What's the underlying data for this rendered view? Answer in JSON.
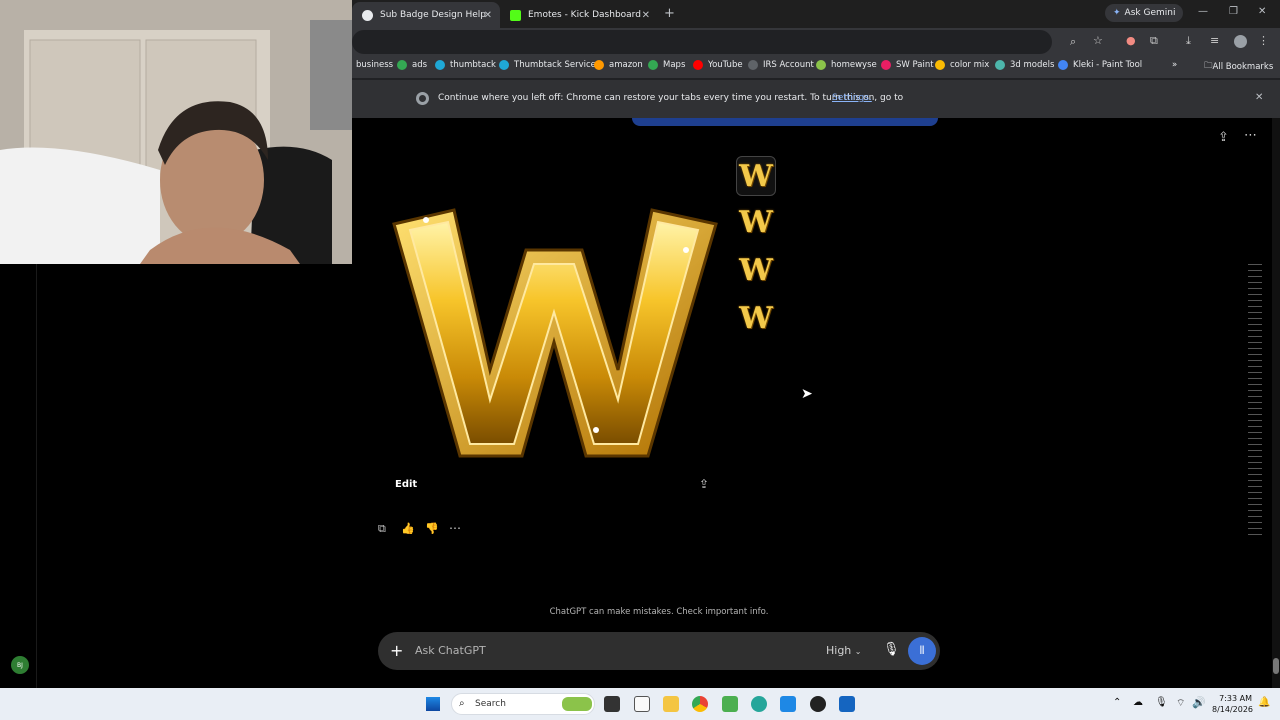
{
  "tabs": [
    {
      "label": "Sub Badge Design Help"
    },
    {
      "label": "Emotes - Kick Dashboard"
    }
  ],
  "new_tab": "+",
  "ask_gemini": "Ask Gemini",
  "bookmarks": [
    {
      "label": "business",
      "color": "#9aa0a6"
    },
    {
      "label": "ads",
      "color": "#34a853"
    },
    {
      "label": "thumbtack",
      "color": "#1fa8d6"
    },
    {
      "label": "Thumbtack Services",
      "color": "#1fa8d6"
    },
    {
      "label": "amazon",
      "color": "#ff9900"
    },
    {
      "label": "Maps",
      "color": "#34a853"
    },
    {
      "label": "YouTube",
      "color": "#ff0000"
    },
    {
      "label": "IRS Account",
      "color": "#5f6368"
    },
    {
      "label": "homewyse",
      "color": "#8bc34a"
    },
    {
      "label": "SW Paint",
      "color": "#e91e63"
    },
    {
      "label": "color mix",
      "color": "#fbbc04"
    },
    {
      "label": "3d models",
      "color": "#4db6ac"
    },
    {
      "label": "Kleki - Paint Tool",
      "color": "#4285f4"
    }
  ],
  "all_bookmarks": "All Bookmarks",
  "infobar": {
    "text": "Continue where you left off: Chrome can restore your tabs every time you restart. To turn this on, go to",
    "link": "Settings."
  },
  "image": {
    "letter": "W"
  },
  "thumbs": [
    "W",
    "W",
    "W",
    "W"
  ],
  "edit_label": "Edit",
  "disclaimer": "ChatGPT can make mistakes. Check important info.",
  "composer": {
    "placeholder": "Ask ChatGPT",
    "model": "High"
  },
  "avatar": "BJ",
  "taskbar": {
    "search": "Search",
    "time": "7:33 AM",
    "date": "8/14/2026"
  },
  "colors": {
    "accent": "#3b6fd6",
    "gold": "#f3c94a"
  }
}
